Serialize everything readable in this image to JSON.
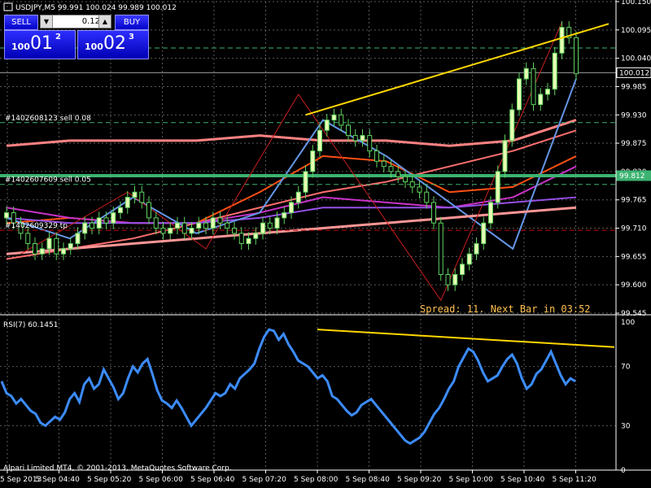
{
  "window": {
    "title": "USDJPY,M5  99.991 100.024 99.989 100.012",
    "copyright": "Alpari Limited MT4, © 2001-2013, MetaQuotes Software Corp."
  },
  "trade_panel": {
    "sell_label": "SELL",
    "buy_label": "BUY",
    "lot_value": "0.12",
    "sell_price": {
      "prefix": "100",
      "big": "01",
      "sup": "2"
    },
    "buy_price": {
      "prefix": "100",
      "big": "02",
      "sup": "3"
    },
    "colors": {
      "button": "#0000c8",
      "border": "#8c8cff"
    }
  },
  "orders": [
    {
      "label": "#1402608123 sell 0.08",
      "price": 99.915,
      "color": "#3cb371",
      "style": "dashed"
    },
    {
      "label": "#1402607609 sell 0.05",
      "price": 99.795,
      "color": "#3cb371",
      "style": "dashed"
    },
    {
      "label": "#1402609329 tp",
      "price": 99.706,
      "color": "#c00000",
      "style": "dashed"
    }
  ],
  "levels": [
    {
      "price": 100.06,
      "color": "#3cb371",
      "style": "dashed"
    },
    {
      "price": 99.812,
      "color": "#3cb371",
      "style": "solid"
    }
  ],
  "price_tags": [
    {
      "text": "100.012",
      "price": 100.012,
      "bg": "#000000",
      "fg": "#ffffff"
    },
    {
      "text": "99.812",
      "price": 99.812,
      "bg": "#3cb371",
      "fg": "#ffffff"
    }
  ],
  "overlay_text": "Spread: 11. Next Bar in 03:52",
  "rsi_title": "RSI(7) 60.1451",
  "chart_data": [
    {
      "type": "candlestick",
      "symbol": "USDJPY",
      "timeframe": "M5",
      "ylim": [
        99.545,
        100.15
      ],
      "y_ticks": [
        "100.150",
        "100.095",
        "100.040",
        "99.985",
        "99.930",
        "99.875",
        "99.820",
        "99.765",
        "99.710",
        "99.655",
        "99.600",
        "99.545"
      ],
      "x_ticks": [
        "5 Sep 2013",
        "5 Sep 04:40",
        "5 Sep 05:20",
        "5 Sep 06:00",
        "5 Sep 06:40",
        "5 Sep 07:20",
        "5 Sep 08:00",
        "5 Sep 08:40",
        "5 Sep 09:20",
        "5 Sep 10:00",
        "5 Sep 10:40",
        "5 Sep 11:20"
      ],
      "last_price": 100.012,
      "colors": {
        "bull": "#e6ffb4",
        "bear": "#000000",
        "wick": "#5fd35f"
      },
      "closes": [
        99.74,
        99.72,
        99.7,
        99.68,
        99.66,
        99.67,
        99.69,
        99.66,
        99.67,
        99.68,
        99.7,
        99.72,
        99.71,
        99.73,
        99.72,
        99.74,
        99.75,
        99.77,
        99.78,
        99.76,
        99.73,
        99.71,
        99.7,
        99.71,
        99.72,
        99.7,
        99.71,
        99.72,
        99.71,
        99.73,
        99.72,
        99.71,
        99.7,
        99.68,
        99.69,
        99.7,
        99.72,
        99.71,
        99.73,
        99.74,
        99.76,
        99.78,
        99.82,
        99.86,
        99.9,
        99.92,
        99.93,
        99.91,
        99.89,
        99.88,
        99.89,
        99.86,
        99.84,
        99.83,
        99.82,
        99.81,
        99.8,
        99.79,
        99.78,
        99.76,
        99.72,
        99.62,
        99.6,
        99.62,
        99.64,
        99.66,
        99.68,
        99.72,
        99.76,
        99.82,
        99.88,
        99.94,
        100.0,
        100.02,
        99.95,
        99.97,
        99.98,
        100.05,
        100.1,
        100.08,
        100.01
      ],
      "moving_averages": [
        {
          "color": "#ff6e6e",
          "values": [
            99.65,
            99.67,
            99.69,
            99.72,
            99.75,
            99.78,
            99.8,
            99.83,
            99.86,
            99.9
          ]
        },
        {
          "color": "#ff8282",
          "values": [
            99.87,
            99.88,
            99.88,
            99.88,
            99.89,
            99.88,
            99.88,
            99.87,
            99.88,
            99.92
          ]
        },
        {
          "color": "#ff5014",
          "values": [
            99.72,
            99.73,
            99.72,
            99.72,
            99.78,
            99.85,
            99.84,
            99.78,
            99.79,
            99.85
          ]
        },
        {
          "color": "#c832c8",
          "values": [
            99.75,
            99.73,
            99.72,
            99.72,
            99.74,
            99.77,
            99.76,
            99.75,
            99.77,
            99.83
          ]
        },
        {
          "color": "#9650e6",
          "values": [
            99.73,
            99.72,
            99.72,
            99.72,
            99.73,
            99.75,
            99.75,
            99.75,
            99.76,
            99.77
          ]
        },
        {
          "color": "#6496e6",
          "values": [
            99.73,
            99.69,
            99.77,
            99.7,
            99.74,
            99.92,
            99.85,
            99.76,
            99.67,
            100.0
          ]
        },
        {
          "color": "#ff9696",
          "values": [
            99.66,
            99.67,
            99.68,
            99.69,
            99.7,
            99.71,
            99.72,
            99.73,
            99.74,
            99.75
          ]
        }
      ],
      "zigzag": [
        {
          "i": 2,
          "p": 99.66
        },
        {
          "i": 17,
          "p": 99.78
        },
        {
          "i": 28,
          "p": 99.67
        },
        {
          "i": 41,
          "p": 99.97
        },
        {
          "i": 61,
          "p": 99.57
        },
        {
          "i": 78,
          "p": 100.11
        }
      ],
      "trendline": {
        "from": {
          "i": 42,
          "p": 99.93
        },
        "to": {
          "i": 86,
          "p": 100.11
        },
        "color": "#ffd700"
      }
    },
    {
      "type": "line",
      "title": "RSI(7) 60.1451",
      "ylim": [
        0,
        100
      ],
      "y_ticks": [
        "100",
        "70",
        "30",
        "0"
      ],
      "color": "#3c8cff",
      "values": [
        60,
        52,
        50,
        45,
        48,
        44,
        40,
        38,
        32,
        30,
        33,
        36,
        34,
        39,
        48,
        52,
        46,
        58,
        62,
        55,
        58,
        68,
        62,
        56,
        48,
        52,
        62,
        70,
        66,
        72,
        75,
        65,
        54,
        47,
        45,
        42,
        47,
        42,
        36,
        30,
        34,
        38,
        42,
        47,
        52,
        50,
        52,
        58,
        55,
        62,
        65,
        68,
        72,
        82,
        90,
        95,
        94,
        88,
        92,
        85,
        80,
        74,
        72,
        70,
        66,
        62,
        64,
        60,
        50,
        48,
        44,
        40,
        37,
        39,
        44,
        46,
        48,
        44,
        40,
        36,
        32,
        28,
        24,
        20,
        18,
        20,
        22,
        26,
        32,
        38,
        42,
        48,
        55,
        60,
        70,
        76,
        82,
        80,
        74,
        66,
        60,
        62,
        64,
        70,
        75,
        78,
        72,
        62,
        55,
        58
      ],
      "values_tail": [
        65,
        68,
        74,
        80,
        72,
        64,
        58,
        62,
        60
      ],
      "trendline": {
        "from": 95,
        "to": 82,
        "color": "#ffd700"
      }
    }
  ]
}
